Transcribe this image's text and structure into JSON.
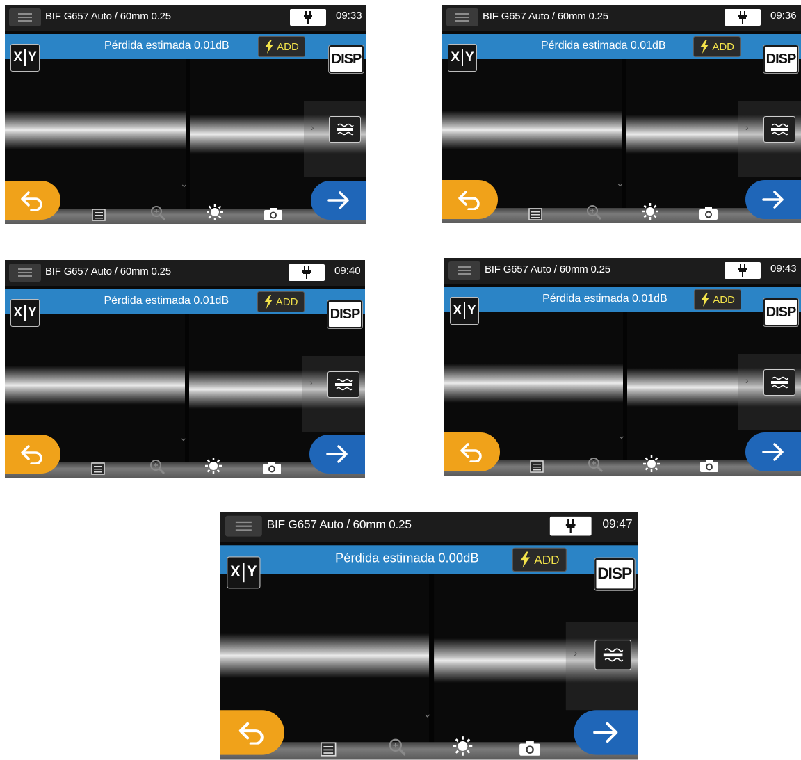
{
  "screens": [
    {
      "title": "BIF G657 Auto / 60mm 0.25",
      "time": "09:33",
      "loss_label": "Pérdida estimada",
      "loss_value": "0.01dB",
      "add_label": "ADD",
      "xy_x": "X",
      "xy_y": "Y",
      "disp_label": "DISP"
    },
    {
      "title": "BIF G657 Auto / 60mm 0.25",
      "time": "09:36",
      "loss_label": "Pérdida estimada",
      "loss_value": "0.01dB",
      "add_label": "ADD",
      "xy_x": "X",
      "xy_y": "Y",
      "disp_label": "DISP"
    },
    {
      "title": "BIF G657 Auto / 60mm 0.25",
      "time": "09:40",
      "loss_label": "Pérdida estimada",
      "loss_value": "0.01dB",
      "add_label": "ADD",
      "xy_x": "X",
      "xy_y": "Y",
      "disp_label": "DISP"
    },
    {
      "title": "BIF G657 Auto / 60mm 0.25",
      "time": "09:43",
      "loss_label": "Pérdida estimada",
      "loss_value": "0.01dB",
      "add_label": "ADD",
      "xy_x": "X",
      "xy_y": "Y",
      "disp_label": "DISP"
    },
    {
      "title": "BIF G657 Auto / 60mm 0.25",
      "time": "09:47",
      "loss_label": "Pérdida estimada",
      "loss_value": "0.00dB",
      "add_label": "ADD",
      "xy_x": "X",
      "xy_y": "Y",
      "disp_label": "DISP"
    }
  ],
  "colors": {
    "accent_blue": "#2b84c6",
    "add_text": "#f2e24a",
    "back_orange": "#f0a21a",
    "next_blue": "#1f66b8"
  },
  "icons": [
    "menu-icon",
    "plug-icon",
    "bolt-icon",
    "fiber-view-icon",
    "back-arrow-icon",
    "next-arrow-icon",
    "report-icon",
    "zoom-icon",
    "brightness-icon",
    "camera-icon"
  ]
}
